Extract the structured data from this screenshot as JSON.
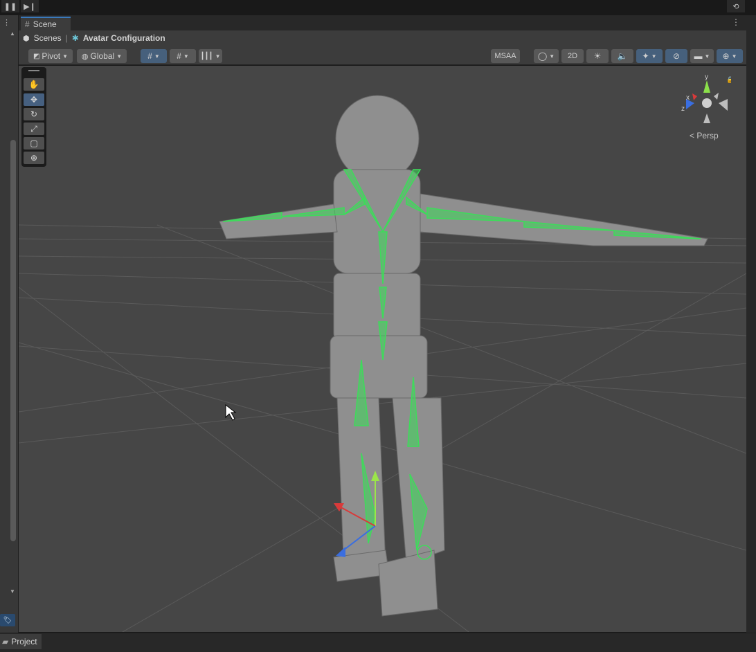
{
  "topbar": {
    "pause_icon": "pause-icon",
    "step_icon": "step-icon",
    "history_icon": "history-icon"
  },
  "tabs": {
    "scene_label": "Scene"
  },
  "breadcrumb": {
    "scenes_label": "Scenes",
    "separator": "|",
    "avatar_label": "Avatar Configuration"
  },
  "toolbar": {
    "pivot_label": "Pivot",
    "global_label": "Global",
    "msaa_label": "MSAA",
    "twod_label": "2D"
  },
  "viewport": {
    "persp_label": "Persp",
    "axis_x": "x",
    "axis_y": "y",
    "axis_z": "z"
  },
  "bottom": {
    "project_label": "Project"
  },
  "colors": {
    "bone": "#3ddc5a",
    "accent": "#3a79bb",
    "viewport_bg": "#464646"
  }
}
